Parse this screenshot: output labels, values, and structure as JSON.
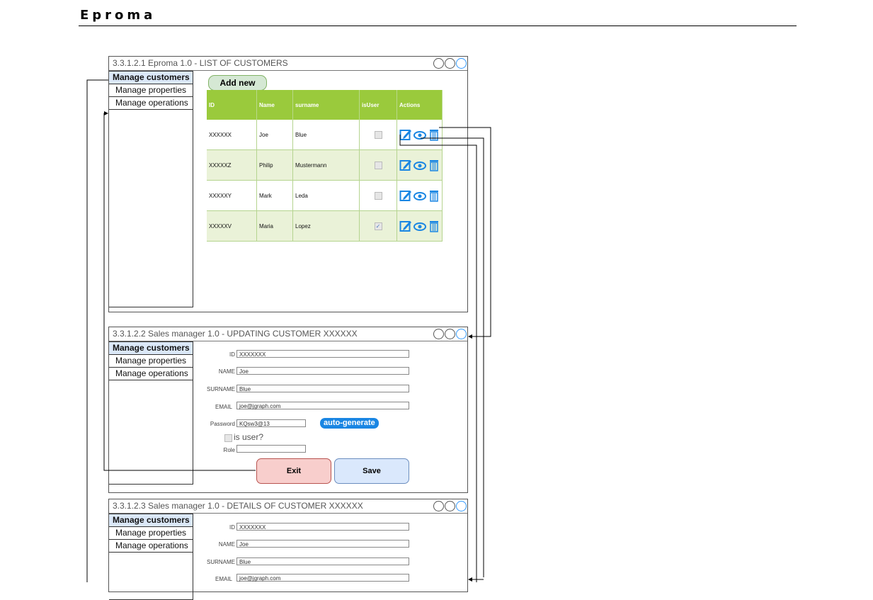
{
  "document": {
    "title": "Eproma"
  },
  "sidebar_items": [
    "Manage customers",
    "Manage properties",
    "Manage operations"
  ],
  "frame1": {
    "title": "3.3.1.2.1 Eproma 1.0 - LIST OF CUSTOMERS",
    "add_new": "Add new",
    "columns": [
      "ID",
      "Name",
      "surname",
      "isUser",
      "Actions"
    ],
    "rows": [
      {
        "id": "XXXXXX",
        "name": "Joe",
        "surname": "Blue",
        "isUser": false
      },
      {
        "id": "XXXXXZ",
        "name": "Philip",
        "surname": "Mustermann",
        "isUser": false
      },
      {
        "id": "XXXXXY",
        "name": "Mark",
        "surname": "Leda",
        "isUser": false
      },
      {
        "id": "XXXXXV",
        "name": "Maria",
        "surname": "Lopez",
        "isUser": true
      }
    ]
  },
  "frame2": {
    "title": "3.3.1.2.2 Sales manager 1.0 - UPDATING CUSTOMER XXXXXX",
    "fields": {
      "id_label": "ID",
      "id_value": "XXXXXXX",
      "name_label": "NAME",
      "name_value": "Joe",
      "surname_label": "SURNAME",
      "surname_value": "Blue",
      "email_label": "EMAIL",
      "email_value": "joe@jgraph.com",
      "password_label": "Password",
      "password_value": "KQsw3@13",
      "auto_generate": "auto-generate",
      "is_user_label": "is user?",
      "role_label": "Role",
      "role_value": ""
    },
    "exit_label": "Exit",
    "save_label": "Save"
  },
  "frame3": {
    "title": "3.3.1.2.3 Sales manager 1.0 - DETAILS OF CUSTOMER XXXXXX",
    "fields": {
      "id_label": "ID",
      "id_value": "XXXXXXX",
      "name_label": "NAME",
      "name_value": "Joe",
      "surname_label": "SURNAME",
      "surname_value": "Blue",
      "email_label": "EMAIL",
      "email_value": "joe@jgraph.com"
    }
  },
  "colors": {
    "header_green": "#9aca3c",
    "accent_blue": "#1a86e3",
    "exit_red": "#f8cecc",
    "save_blue": "#dae8fc"
  },
  "icons": [
    "edit-icon",
    "view-icon",
    "delete-icon"
  ]
}
